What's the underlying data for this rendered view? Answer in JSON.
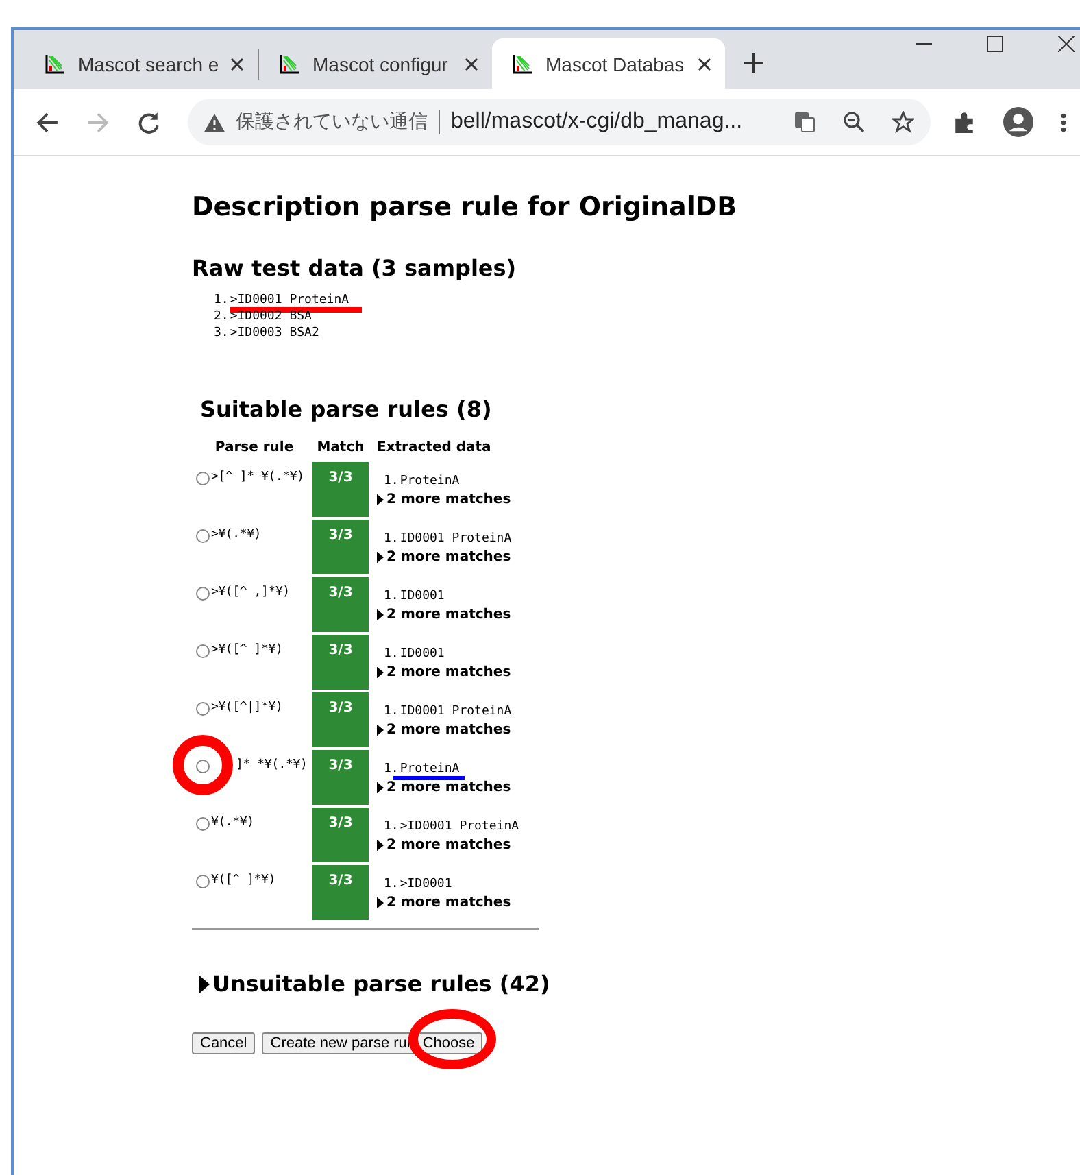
{
  "tabs": [
    {
      "title": "Mascot search e",
      "selected": false
    },
    {
      "title": "Mascot configur",
      "selected": false
    },
    {
      "title": "Mascot Databas",
      "selected": true
    }
  ],
  "address_bar": {
    "security": "保護されていない通信",
    "url": "bell/mascot/x-cgi/db_manag..."
  },
  "page": {
    "title": "Description parse rule for OriginalDB",
    "raw_heading": "Raw test data (3 samples)",
    "samples": [
      {
        "number": "1.",
        "text": ">ID0001 ProteinA",
        "annotation": {
          "kind": "underline",
          "color": "#ff0000"
        }
      },
      {
        "number": "2.",
        "text": ">ID0002 BSA"
      },
      {
        "number": "3.",
        "text": ">ID0003 BSA2"
      }
    ],
    "suitable_heading": "Suitable parse rules (8)",
    "columns": [
      "Parse rule",
      "Match",
      "Extracted data"
    ],
    "rules": [
      {
        "rule": ">[^ ]* ¥(.*¥)",
        "match": "3/3",
        "number": "1.",
        "extracted": "ProteinA",
        "more": "2 more matches",
        "selected": false
      },
      {
        "rule": ">¥(.*¥)",
        "match": "3/3",
        "number": "1.",
        "extracted": "ID0001 ProteinA",
        "more": "2 more matches",
        "selected": false
      },
      {
        "rule": ">¥([^ ,]*¥)",
        "match": "3/3",
        "number": "1.",
        "extracted": "ID0001",
        "more": "2 more matches",
        "selected": false
      },
      {
        "rule": ">¥([^ ]*¥)",
        "match": "3/3",
        "number": "1.",
        "extracted": "ID0001",
        "more": "2 more matches",
        "selected": false
      },
      {
        "rule": ">¥([^|]*¥)",
        "match": "3/3",
        "number": "1.",
        "extracted": "ID0001 ProteinA",
        "more": "2 more matches",
        "selected": false
      },
      {
        "rule": "]* *¥(.*¥)",
        "match": "3/3",
        "number": "1.",
        "extracted": "ProteinA",
        "more": "2 more matches",
        "selected": false,
        "radio_annotation": {
          "kind": "circle",
          "color": "#ff0000"
        },
        "extracted_annotation": {
          "kind": "underline",
          "color": "#0000ff"
        }
      },
      {
        "rule": "¥(.*¥)",
        "match": "3/3",
        "number": "1.",
        "extracted": ">ID0001 ProteinA",
        "more": "2 more matches",
        "selected": false
      },
      {
        "rule": "¥([^ ]*¥)",
        "match": "3/3",
        "number": "1.",
        "extracted": ">ID0001",
        "more": "2 more matches",
        "selected": false
      }
    ],
    "unsuitable_heading": "Unsuitable parse rules (42)",
    "buttons": [
      {
        "label": "Cancel"
      },
      {
        "label": "Create new parse rul"
      },
      {
        "label": "Choose",
        "annotation": {
          "kind": "circle",
          "color": "#ff0000"
        }
      }
    ]
  }
}
